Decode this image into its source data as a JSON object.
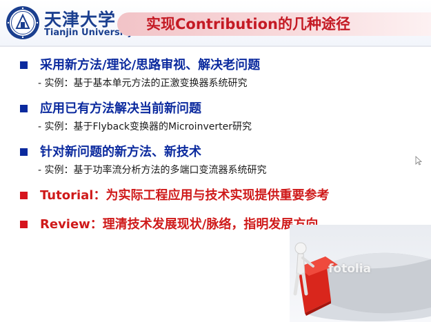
{
  "header": {
    "university_cn": "天津大学",
    "university_en": "Tianjin University",
    "title": "实现Contribution的几种途径"
  },
  "bullets": [
    {
      "text": "采用新方法/理论/思路审视、解决老问题",
      "color": "#0b2a9e",
      "sub": "- 实例：基于基本单元方法的正激变换器系统研究"
    },
    {
      "text": "应用已有方法解决当前新问题",
      "color": "#0b2a9e",
      "sub": "- 实例：基于Flyback变换器的Microinverter研究"
    },
    {
      "text": "针对新问题的新方法、新技术",
      "color": "#0b2a9e",
      "sub": "- 实例：基于功率流分析方法的多端口变流器系统研究"
    },
    {
      "text": "Tutorial：为实际工程应用与技术实现提供重要参考",
      "color": "#cf1a1a"
    },
    {
      "text": "Review：理清技术发展现状/脉络，指明发展方向",
      "color": "#cf1a1a"
    }
  ],
  "graphic": {
    "watermark": "fotolia",
    "slice_color": "#d9261c",
    "pie_color": "#c9cdd3"
  }
}
